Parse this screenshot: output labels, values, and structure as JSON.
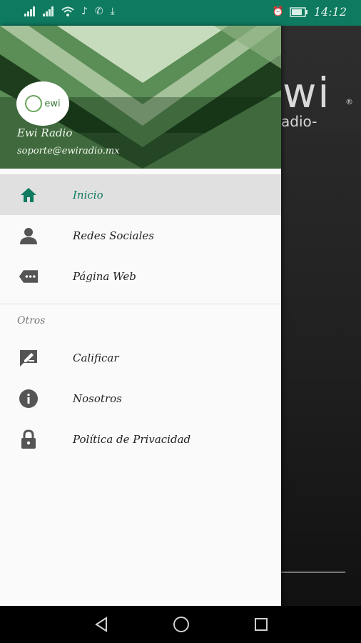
{
  "status_bar": {
    "time": "14:12",
    "left_icons": [
      "signal-icon",
      "signal-icon",
      "wifi-icon",
      "music-icon",
      "call-icon",
      "download-icon"
    ],
    "right_icons": [
      "alarm-icon",
      "battery-icon"
    ]
  },
  "background_app": {
    "logo_text": "wi",
    "reg_mark": "®",
    "subtitle": "adio-"
  },
  "drawer": {
    "header": {
      "logo_text": "ewi",
      "app_name": "Ewi Radio",
      "email": "soporte@ewiradio.mx"
    },
    "main_items": [
      {
        "label": "Inicio",
        "icon": "home-icon",
        "active": true
      },
      {
        "label": "Redes Sociales",
        "icon": "person-icon",
        "active": false
      },
      {
        "label": "Página Web",
        "icon": "label-more-icon",
        "active": false
      }
    ],
    "section_title": "Otros",
    "other_items": [
      {
        "label": "Calificar",
        "icon": "rate-review-icon"
      },
      {
        "label": "Nosotros",
        "icon": "info-icon"
      },
      {
        "label": "Política de Privacidad",
        "icon": "lock-icon"
      }
    ]
  },
  "colors": {
    "accent": "#0e7a60",
    "active_bg": "#e0e0e0",
    "icon": "#555555"
  },
  "nav_bar": [
    "back-icon",
    "home-circle-icon",
    "recents-icon"
  ]
}
